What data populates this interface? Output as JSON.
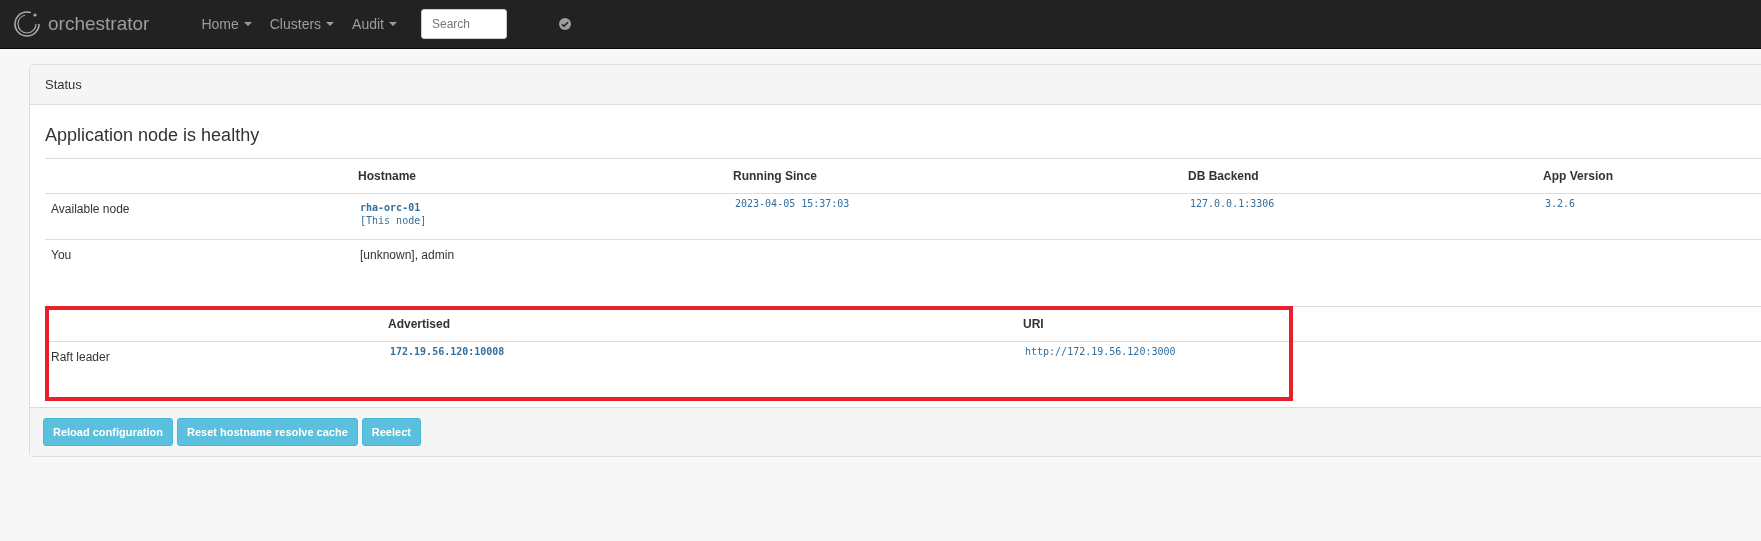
{
  "navbar": {
    "brand": "orchestrator",
    "menus": [
      {
        "label": "Home"
      },
      {
        "label": "Clusters"
      },
      {
        "label": "Audit"
      }
    ],
    "search": {
      "placeholder": "Search"
    }
  },
  "panel": {
    "title": "Status",
    "heading": "Application node is healthy",
    "nodes_table": {
      "columns": [
        "Hostname",
        "Running Since",
        "DB Backend",
        "App Version"
      ],
      "rows": [
        {
          "label": "Available node",
          "hostname": "rha-orc-01",
          "note": "[This node]",
          "running_since": "2023-04-05 15:37:03",
          "db_backend": "127.0.0.1:3306",
          "app_version": "3.2.6"
        },
        {
          "label": "You",
          "hostname": "[unknown], admin"
        }
      ]
    },
    "raft_table": {
      "highlighted": true,
      "columns": [
        "Advertised",
        "URI"
      ],
      "rows": [
        {
          "label": "Raft leader",
          "advertised": "172.19.56.120:10008",
          "uri": "http://172.19.56.120:3000"
        }
      ]
    },
    "buttons": [
      "Reload configuration",
      "Reset hostname resolve cache",
      "Reelect"
    ]
  }
}
